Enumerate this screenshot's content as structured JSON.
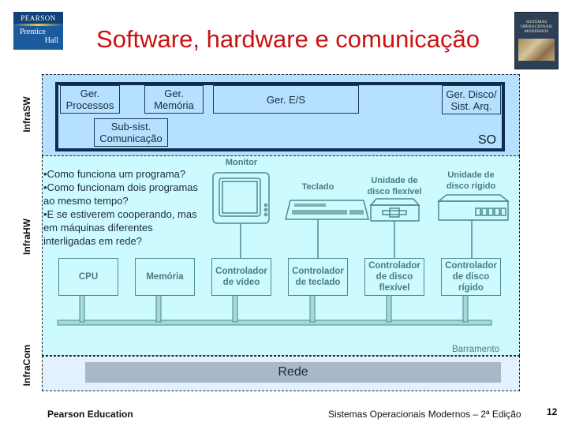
{
  "slide": {
    "title": "Software, hardware e comunicação",
    "logo": {
      "brand": "PEARSON",
      "line1": "Prentice",
      "line2": "Hall"
    },
    "book_cover": {
      "title_lines": [
        "SISTEMAS",
        "OPERACIONAIS",
        "MODERNOS"
      ]
    }
  },
  "layers": {
    "infra_sw": "InfraSW",
    "infra_hw": "InfraHW",
    "infra_com": "InfraCom"
  },
  "so": {
    "label": "SO",
    "components": {
      "processos": "Ger.\nProcessos",
      "memoria": "Ger.\nMemória",
      "es": "Ger. E/S",
      "disco": "Ger. Disco/\nSist. Arq.",
      "comunicacao": "Sub-sist.\nComunicação"
    }
  },
  "questions": [
    "•Como funciona um programa?",
    "•Como funcionam dois programas ao mesmo tempo?",
    "•E se estiverem cooperando, mas em máquinas diferentes interligadas em rede?"
  ],
  "hardware": {
    "devices": {
      "monitor": "Monitor",
      "teclado": "Teclado",
      "disco_flexivel": "Unidade de\ndisco flexível",
      "disco_rigido": "Unidade de\ndisco rígido"
    },
    "boxes": {
      "cpu": "CPU",
      "memoria": "Memória",
      "ctrl_video": "Controlador\nde vídeo",
      "ctrl_teclado": "Controlador\nde teclado",
      "ctrl_flexivel": "Controlador\nde disco\nflexível",
      "ctrl_rigido": "Controlador\nde disco\nrígido"
    },
    "bus_label": "Barramento"
  },
  "network": {
    "label": "Rede"
  },
  "footer": {
    "publisher": "Pearson Education",
    "book": "Sistemas Operacionais Modernos – 2ª Edição",
    "page": "12"
  }
}
